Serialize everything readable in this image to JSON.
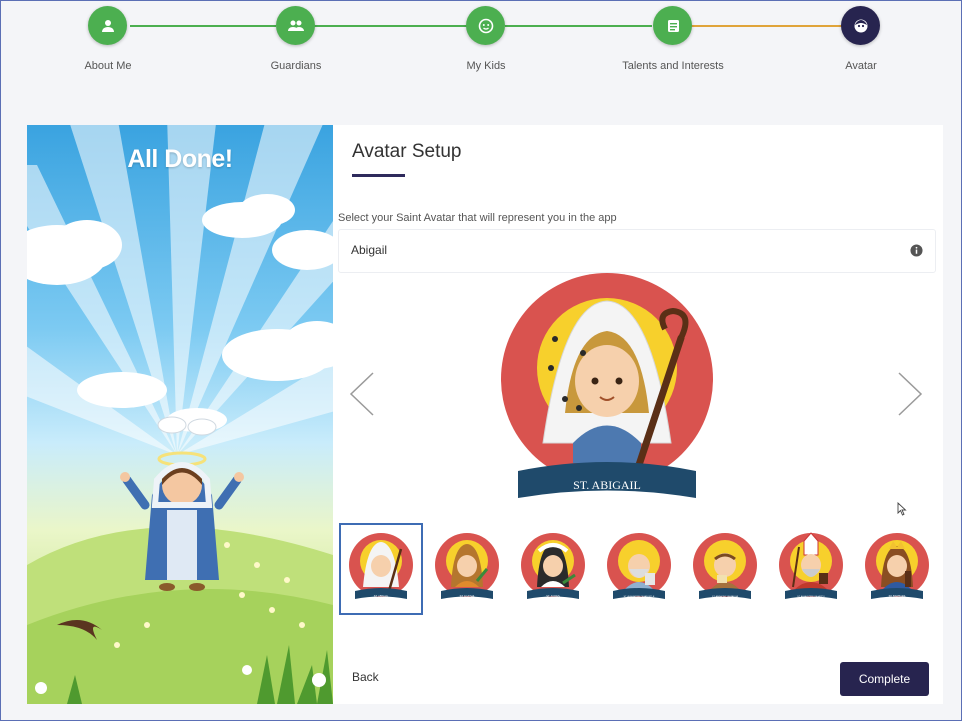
{
  "stepper": {
    "steps": [
      {
        "label": "About Me",
        "icon": "person-icon",
        "state": "completed"
      },
      {
        "label": "Guardians",
        "icon": "people-icon",
        "state": "completed"
      },
      {
        "label": "My Kids",
        "icon": "face-icon",
        "state": "completed"
      },
      {
        "label": "Talents and Interests",
        "icon": "list-icon",
        "state": "completed"
      },
      {
        "label": "Avatar",
        "icon": "avatar-icon",
        "state": "active"
      }
    ],
    "colors": {
      "completed": "#4caf50",
      "active": "#27244f",
      "connector_active": "#e0a43a"
    }
  },
  "left_panel": {
    "title": "All Done!"
  },
  "avatar_setup": {
    "title": "Avatar Setup",
    "instruction": "Select your Saint Avatar that will represent you in the app",
    "selected_name": "Abigail",
    "info_icon": "info-icon",
    "main_avatar_caption": "ST. ABIGAIL",
    "nav": {
      "prev_icon": "chevron-left-icon",
      "next_icon": "chevron-right-icon"
    },
    "thumbnails": [
      {
        "caption": "ST. ABIGAIL",
        "selected": true
      },
      {
        "caption": "ST. AGATHA",
        "selected": false
      },
      {
        "caption": "ST. AGNES",
        "selected": false
      },
      {
        "caption": "ST. AUGUSTINE OF APOSTLE",
        "selected": false
      },
      {
        "caption": "ST. ANTHONY OF PADUA",
        "selected": false
      },
      {
        "caption": "ST. AUGUSTINE OF HIPPO",
        "selected": false
      },
      {
        "caption": "ST. BARBARA",
        "selected": false
      }
    ]
  },
  "footer": {
    "back_label": "Back",
    "complete_label": "Complete"
  },
  "colors": {
    "accent": "#27244f",
    "selection": "#3e6cb4",
    "avatar_red": "#d9534f"
  }
}
